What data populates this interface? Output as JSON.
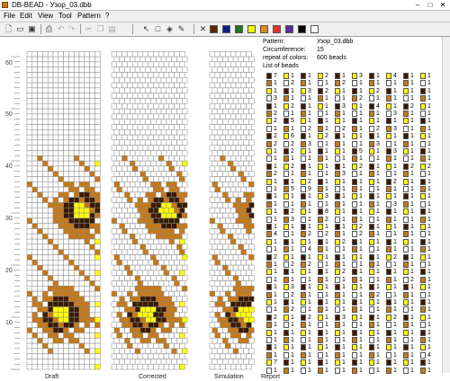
{
  "window": {
    "title": "DB-BEAD - Узор_03.dbb",
    "minimize": "–",
    "maximize": "□",
    "close": "✕"
  },
  "menu": [
    {
      "label": "File"
    },
    {
      "label": "Edit"
    },
    {
      "label": "View"
    },
    {
      "label": "Tool"
    },
    {
      "label": "Pattern"
    },
    {
      "label": "?"
    }
  ],
  "toolbar": {
    "icons": [
      "new-file-icon",
      "open-folder-icon",
      "save-icon",
      "print-icon",
      "undo-icon",
      "redo-icon",
      "cut-icon",
      "copy-icon",
      "paste-icon",
      "pointer-icon",
      "select-rect-icon",
      "fill-icon",
      "pipette-icon",
      "delete-icon"
    ],
    "palette": [
      "#5a2a00",
      "#0a1e8c",
      "#1e7a1e",
      "#ffff00",
      "#d88a1a",
      "#e03030",
      "#5a2a9a",
      "#000000",
      "#ffffff"
    ]
  },
  "ruler": {
    "labels": [
      "60",
      "50",
      "40",
      "30",
      "20",
      "10"
    ]
  },
  "views": [
    {
      "label": "Draft"
    },
    {
      "label": "Corrected"
    },
    {
      "label": "Simulation"
    },
    {
      "label": "Report"
    }
  ],
  "report": {
    "pattern_label": "Pattern:",
    "pattern_value": "Узор_03.dbb",
    "circumference_label": "Circumference:",
    "circumference_value": "15",
    "repeat_label": "repeat of colors:",
    "repeat_value": "600 beads",
    "list_label": "List of beads"
  },
  "bead_colors": {
    "brown": "#c87814",
    "dark": "#3a1a00",
    "yellow": "#ffff00",
    "white": "#ffffff"
  },
  "bead_list": [
    [
      "7",
      "1",
      "1",
      "2",
      "1",
      "3",
      "1",
      "4",
      "1",
      "1"
    ],
    [
      "1",
      "2",
      "1",
      "1",
      "2",
      "1",
      "1",
      "1",
      "1",
      "1"
    ],
    [
      "1",
      "1",
      "3",
      "2",
      "1",
      "1",
      "2",
      "1",
      "1",
      "1"
    ],
    [
      "3",
      "1",
      "1",
      "1",
      "1",
      "2",
      "1",
      "1",
      "1",
      "1"
    ],
    [
      "1",
      "2",
      "1",
      "1",
      "3",
      "1",
      "4",
      "1",
      "2",
      "1"
    ],
    [
      "2",
      "1",
      "1",
      "1",
      "1",
      "1",
      "1",
      "3",
      "1",
      "1"
    ],
    [
      "2",
      "5",
      "1",
      "1",
      "1",
      "1",
      "1",
      "1",
      "1",
      "1"
    ],
    [
      "1",
      "1",
      "2",
      "1",
      "2",
      "1",
      "2",
      "3",
      "1",
      "1"
    ],
    [
      "2",
      "6",
      "1",
      "2",
      "1",
      "1",
      "1",
      "1",
      "1",
      "1"
    ],
    [
      "2",
      "2",
      "3",
      "1",
      "1",
      "1",
      "3",
      "1",
      "1",
      "1"
    ],
    [
      "1",
      "2",
      "1",
      "1",
      "1",
      "5",
      "1",
      "3",
      "1",
      "1"
    ],
    [
      "1",
      "1",
      "1",
      "1",
      "1",
      "1",
      "1",
      "1",
      "1",
      "1"
    ],
    [
      "1",
      "2",
      "1",
      "1",
      "1",
      "2",
      "1",
      "1",
      "2",
      "2"
    ],
    [
      "2",
      "1",
      "1",
      "1",
      "3",
      "1",
      "1",
      "1",
      "1",
      "1"
    ],
    [
      "1",
      "1",
      "2",
      "1",
      "1",
      "1",
      "1",
      "2",
      "1",
      "1"
    ],
    [
      "1",
      "5",
      "9",
      "1",
      "1",
      "1",
      "1",
      "1",
      "1",
      "1"
    ],
    [
      "1",
      "1",
      "1",
      "3",
      "1",
      "1",
      "1",
      "1",
      "1",
      "1"
    ],
    [
      "1",
      "1",
      "1",
      "1",
      "1",
      "1",
      "1",
      "3",
      "1",
      "1"
    ],
    [
      "1",
      "2",
      "1",
      "8",
      "1",
      "1",
      "1",
      "1",
      "1",
      "1"
    ],
    [
      "1",
      "3",
      "1",
      "2",
      "1",
      "1",
      "1",
      "1",
      "1",
      "1"
    ],
    [
      "1",
      "1",
      "1",
      "1",
      "1",
      "2",
      "1",
      "1",
      "1",
      "1"
    ],
    [
      "4",
      "1",
      "2",
      "2",
      "1",
      "2",
      "1",
      "1",
      "1",
      "1"
    ],
    [
      "1",
      "1",
      "1",
      "1",
      "2",
      "1",
      "1",
      "1",
      "1",
      "1"
    ],
    [
      "1",
      "1",
      "4",
      "1",
      "1",
      "1",
      "1",
      "1",
      "1",
      "1"
    ],
    [
      "2",
      "1",
      "1",
      "1",
      "1",
      "1",
      "1",
      "2",
      "1",
      "1"
    ],
    [
      "1",
      "2",
      "2",
      "1",
      "1",
      "1",
      "1",
      "1",
      "1",
      "1"
    ],
    [
      "1",
      "1",
      "1",
      "1",
      "2",
      "1",
      "1",
      "1",
      "1",
      "1"
    ],
    [
      "1",
      "1",
      "1",
      "1",
      "1",
      "1",
      "1",
      "1",
      "2",
      "1"
    ],
    [
      "1",
      "3",
      "1",
      "1",
      "1",
      "1",
      "1",
      "1",
      "1",
      "1"
    ],
    [
      "1",
      "2",
      "1",
      "1",
      "1",
      "1",
      "2",
      "1",
      "1",
      "1"
    ],
    [
      "1",
      "1",
      "1",
      "1",
      "1",
      "1",
      "1",
      "1",
      "1",
      "1"
    ],
    [
      "1",
      "2",
      "1",
      "1",
      "1",
      "1",
      "1",
      "1",
      "1",
      "1"
    ],
    [
      "2",
      "1",
      "2",
      "1",
      "3",
      "1",
      "1",
      "2",
      "1",
      "1"
    ],
    [
      "1",
      "1",
      "1",
      "1",
      "1",
      "1",
      "1",
      "1",
      "1",
      "1"
    ],
    [
      "1",
      "1",
      "1",
      "1",
      "1",
      "1",
      "1",
      "1",
      "1",
      "1"
    ],
    [
      "1",
      "1",
      "1",
      "1",
      "1",
      "1",
      "1",
      "1",
      "1",
      "1"
    ],
    [
      "1",
      "1",
      "1",
      "1",
      "1",
      "1",
      "1",
      "1",
      "1",
      "1"
    ],
    [
      "1",
      "1",
      "1",
      "1",
      "1",
      "1",
      "1",
      "1",
      "1",
      "4"
    ],
    [
      "7",
      "1",
      "1",
      "1",
      "1",
      "1",
      "1",
      "1",
      "1",
      "1"
    ],
    [
      "1",
      "1",
      "1",
      "1",
      "1",
      "1",
      "1",
      "1",
      "1",
      "1"
    ]
  ]
}
